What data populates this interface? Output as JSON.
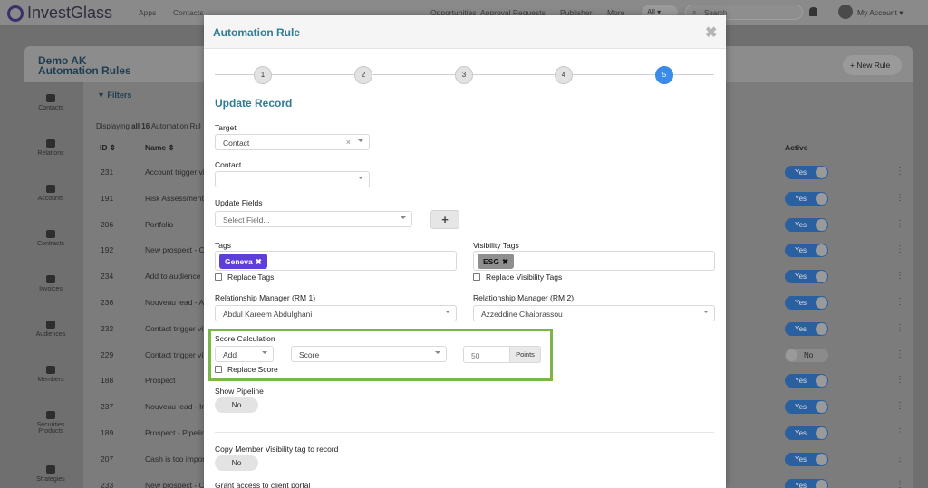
{
  "app": {
    "logo_text": "InvestGlass",
    "nav": {
      "apps": "Apps",
      "contacts": "Contacts",
      "opportunities": "Opportunities",
      "approval_requests": "Approval Requests",
      "publisher": "Publisher",
      "more": "More"
    },
    "scope_select": "All ▾",
    "search_placeholder": "Search",
    "account_label": "My Account ▾"
  },
  "sidebar": {
    "items": [
      "Contacts",
      "Relations",
      "Accounts",
      "Contracts",
      "Invoices",
      "Audiences",
      "Members",
      "Securities Products",
      "Strategies"
    ]
  },
  "page": {
    "title_line1": "Demo AK",
    "title_line2": "Automation Rules",
    "new_rule_button": "+ New Rule",
    "filters_label": "Filters",
    "displaying_prefix": "Displaying ",
    "displaying_bold": "all 16",
    "displaying_suffix": " Automation Rul",
    "columns": {
      "id": "ID ⇕",
      "name": "Name ⇕",
      "active": "Active"
    },
    "rows": [
      {
        "id": "231",
        "name": "Account trigger vi",
        "active": "Yes"
      },
      {
        "id": "191",
        "name": "Risk Assessment",
        "active": "Yes"
      },
      {
        "id": "206",
        "name": "Portfolio",
        "active": "Yes"
      },
      {
        "id": "192",
        "name": "New prospect - C",
        "active": "Yes"
      },
      {
        "id": "234",
        "name": "Add to audience",
        "active": "Yes"
      },
      {
        "id": "236",
        "name": "Nouveau lead - Ac",
        "active": "Yes"
      },
      {
        "id": "232",
        "name": "Contact trigger vi",
        "active": "Yes"
      },
      {
        "id": "229",
        "name": "Contact trigger vi",
        "active": "No"
      },
      {
        "id": "188",
        "name": "Prospect",
        "active": "Yes"
      },
      {
        "id": "237",
        "name": "Nouveau lead - In",
        "active": "Yes"
      },
      {
        "id": "189",
        "name": "Prospect - Pipelin",
        "active": "Yes"
      },
      {
        "id": "207",
        "name": "Cash is too impor",
        "active": "Yes"
      },
      {
        "id": "233",
        "name": "New prospect - C",
        "active": "Yes"
      }
    ]
  },
  "modal": {
    "title": "Automation Rule",
    "close_glyph": "✖",
    "steps": [
      "1",
      "2",
      "3",
      "4",
      "5"
    ],
    "active_step": 5,
    "section_title": "Update Record",
    "target": {
      "label": "Target",
      "value": "Contact"
    },
    "contact": {
      "label": "Contact",
      "value": ""
    },
    "update_fields": {
      "label": "Update Fields",
      "placeholder": "Select Field...",
      "add_button": "+"
    },
    "tags": {
      "label": "Tags",
      "values": [
        "Geneva"
      ],
      "replace_label": "Replace Tags"
    },
    "visibility_tags": {
      "label": "Visibility Tags",
      "values": [
        "ESG"
      ],
      "replace_label": "Replace Visibility Tags"
    },
    "rm1": {
      "label": "Relationship Manager (RM 1)",
      "value": "Abdul Kareem Abdulghani"
    },
    "rm2": {
      "label": "Relationship Manager (RM 2)",
      "value": "Azzeddine Chaibrassou"
    },
    "score": {
      "label": "Score Calculation",
      "operation": "Add",
      "field": "Score",
      "points_value": "50",
      "points_unit": "Points",
      "replace_label": "Replace Score"
    },
    "show_pipeline": {
      "label": "Show Pipeline",
      "value": "No"
    },
    "copy_visibility": {
      "label": "Copy Member Visibility tag to record",
      "value": "No"
    },
    "grant_access": {
      "label": "Grant access to client portal"
    }
  },
  "colors": {
    "accent_teal": "#2f7d95",
    "step_active": "#3b8be8",
    "tag_geneva": "#5e3ed8",
    "highlight_green": "#7ab648"
  }
}
